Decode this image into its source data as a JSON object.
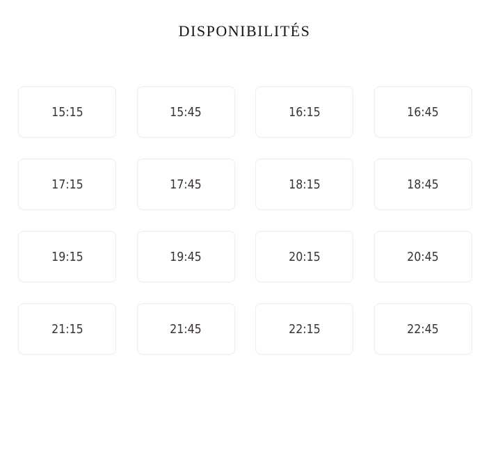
{
  "heading": "DISPONIBILITÉS",
  "slots": [
    {
      "time": "15:15"
    },
    {
      "time": "15:45"
    },
    {
      "time": "16:15"
    },
    {
      "time": "16:45"
    },
    {
      "time": "17:15"
    },
    {
      "time": "17:45"
    },
    {
      "time": "18:15"
    },
    {
      "time": "18:45"
    },
    {
      "time": "19:15"
    },
    {
      "time": "19:45"
    },
    {
      "time": "20:15"
    },
    {
      "time": "20:45"
    },
    {
      "time": "21:15"
    },
    {
      "time": "21:45"
    },
    {
      "time": "22:15"
    },
    {
      "time": "22:45"
    }
  ],
  "colors": {
    "background": "#ffffff",
    "border": "#ececec",
    "text": "#3a3232",
    "heading": "#1a1414"
  }
}
